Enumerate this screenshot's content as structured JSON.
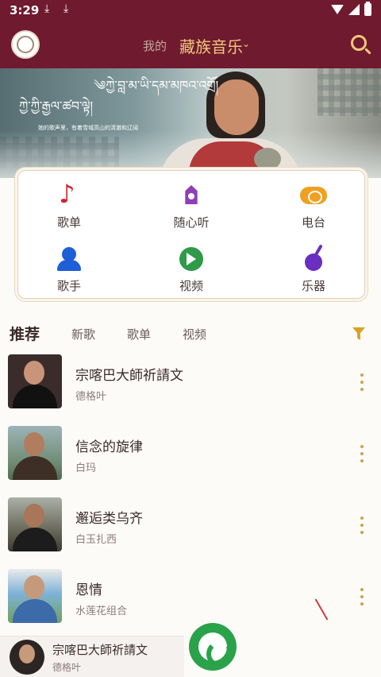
{
  "status": {
    "time": "3:29"
  },
  "header": {
    "tab_mine": "我的",
    "tab_main": "藏族音乐",
    "caret": "⌄"
  },
  "banner": {
    "tibetan_line1": "༄ཀྱེ་བླ་མ་ཡི་དམ་མཁའ་འགྲོ།",
    "tibetan_line2": "ཀྱེ་ཀྱི་རྒྱལ་ཚབ་ལྟེ།",
    "caption": "她的歌声里，有着雪域高山的清澈和辽阔"
  },
  "features": [
    {
      "label": "歌单",
      "icon": "playlist-icon"
    },
    {
      "label": "随心听",
      "icon": "random-listen-icon"
    },
    {
      "label": "电台",
      "icon": "radio-icon"
    },
    {
      "label": "歌手",
      "icon": "singer-icon"
    },
    {
      "label": "视频",
      "icon": "video-icon"
    },
    {
      "label": "乐器",
      "icon": "instrument-icon"
    }
  ],
  "sections": {
    "active": "推荐",
    "tabs": [
      "新歌",
      "歌单",
      "视频"
    ]
  },
  "songs": [
    {
      "title": "宗喀巴大師祈請文",
      "artist": "德格叶"
    },
    {
      "title": "信念的旋律",
      "artist": "白玛"
    },
    {
      "title": "邂逅类乌齐",
      "artist": "白玉扎西"
    },
    {
      "title": "恩情",
      "artist": "水莲花组合"
    }
  ],
  "player": {
    "title": "宗喀巴大師祈請文",
    "artist": "德格叶"
  },
  "colors": {
    "header": "#6f1a2e",
    "accent": "#f2c77c",
    "icon_gold": "#d1a24a"
  }
}
